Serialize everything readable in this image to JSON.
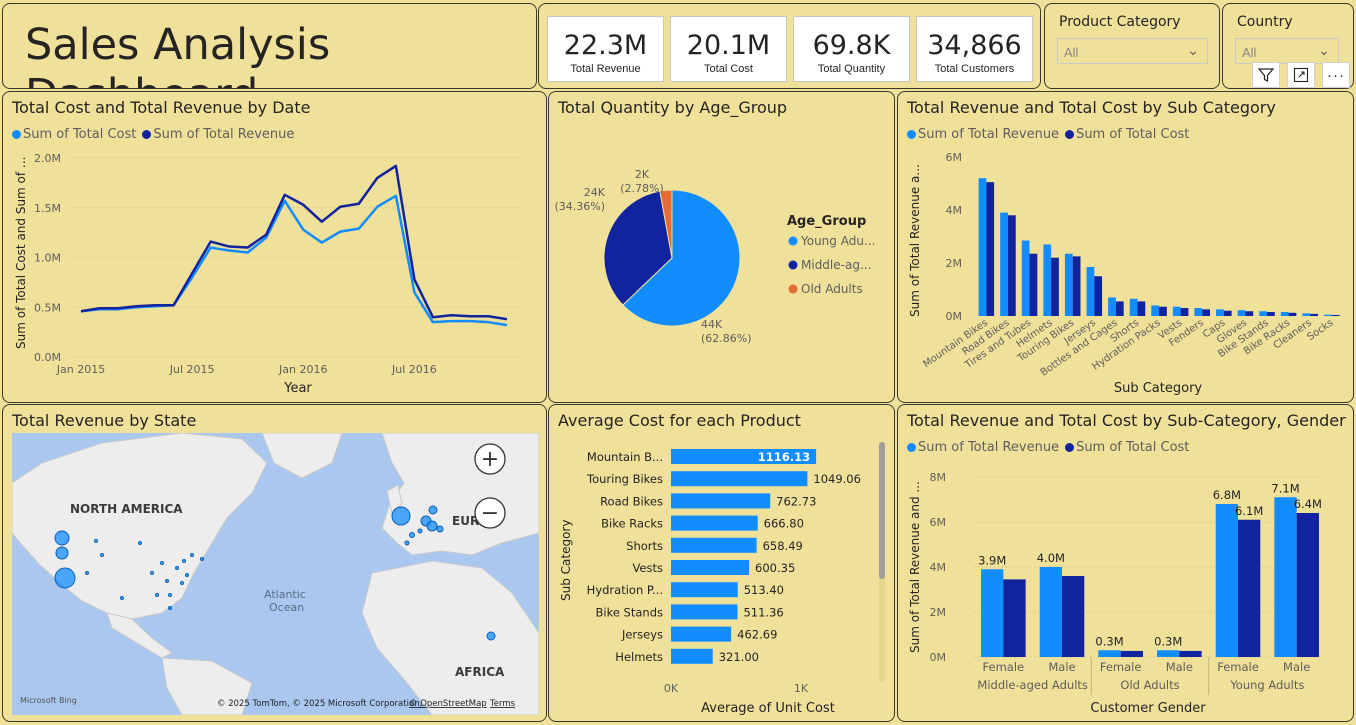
{
  "header": {
    "title": "Sales Analysis Dashboard"
  },
  "kpis": [
    {
      "value": "22.3M",
      "label": "Total Revenue"
    },
    {
      "value": "20.1M",
      "label": "Total Cost"
    },
    {
      "value": "69.8K",
      "label": "Total Quantity"
    },
    {
      "value": "34,866",
      "label": "Total Customers"
    }
  ],
  "slicers": {
    "product_category": {
      "title": "Product Category",
      "value": "All"
    },
    "country": {
      "title": "Country",
      "value": "All"
    }
  },
  "toolbar": {
    "filter_icon": "filter-icon",
    "focus_icon": "focus-mode-icon",
    "more_label": "···"
  },
  "colors": {
    "background": "#efe09a",
    "light_blue": "#118dff",
    "dark_blue": "#12239e",
    "orange": "#e66c37"
  },
  "chart_data": [
    {
      "type": "line",
      "title": "Total Cost and Total Revenue by Date",
      "xlabel": "Year",
      "ylabel": "Sum of Total Cost and Sum of ...",
      "x_ticks": [
        "Jan 2015",
        "Jul 2015",
        "Jan 2016",
        "Jul 2016"
      ],
      "y_ticks": [
        "0.0M",
        "0.5M",
        "1.0M",
        "1.5M",
        "2.0M"
      ],
      "ylim": [
        0,
        2.0
      ],
      "x": [
        "2015-01",
        "2015-02",
        "2015-03",
        "2015-04",
        "2015-05",
        "2015-06",
        "2015-07",
        "2015-08",
        "2015-09",
        "2015-10",
        "2015-11",
        "2015-12",
        "2016-01",
        "2016-02",
        "2016-03",
        "2016-04",
        "2016-05",
        "2016-06",
        "2016-07",
        "2016-08",
        "2016-09",
        "2016-10",
        "2016-11",
        "2016-12"
      ],
      "series": [
        {
          "name": "Sum of Total Cost",
          "color": "#118dff",
          "values": [
            0.46,
            0.48,
            0.48,
            0.5,
            0.51,
            0.52,
            0.8,
            1.1,
            1.07,
            1.05,
            1.2,
            1.57,
            1.28,
            1.15,
            1.26,
            1.29,
            1.51,
            1.62,
            0.65,
            0.35,
            0.36,
            0.36,
            0.35,
            0.32
          ]
        },
        {
          "name": "Sum of Total Revenue",
          "color": "#12239e",
          "values": [
            0.46,
            0.49,
            0.49,
            0.51,
            0.52,
            0.52,
            0.84,
            1.16,
            1.11,
            1.1,
            1.23,
            1.63,
            1.53,
            1.36,
            1.51,
            1.54,
            1.8,
            1.92,
            0.78,
            0.4,
            0.42,
            0.41,
            0.41,
            0.38
          ]
        }
      ]
    },
    {
      "type": "pie",
      "title": "Total Quantity by Age_Group",
      "legend_title": "Age_Group",
      "slices": [
        {
          "name": "Young Adu...",
          "value": 44,
          "label": "44K",
          "pct": "(62.86%)",
          "color": "#118dff"
        },
        {
          "name": "Middle-ag...",
          "value": 24,
          "label": "24K",
          "pct": "(34.36%)",
          "color": "#12239e"
        },
        {
          "name": "Old Adults",
          "value": 2,
          "label": "2K",
          "pct": "(2.78%)",
          "color": "#e66c37"
        }
      ]
    },
    {
      "type": "bar",
      "title": "Total Revenue and Total Cost by Sub Category",
      "xlabel": "Sub Category",
      "ylabel": "Sum of Total Revenue a...",
      "y_ticks": [
        "0M",
        "2M",
        "4M",
        "6M"
      ],
      "ylim": [
        0,
        6
      ],
      "categories": [
        "Mountain Bikes",
        "Road Bikes",
        "Tires and Tubes",
        "Helmets",
        "Touring Bikes",
        "Jerseys",
        "Bottles and Cages",
        "Shorts",
        "Hydration Packs",
        "Vests",
        "Fenders",
        "Caps",
        "Gloves",
        "Bike Stands",
        "Bike Racks",
        "Cleaners",
        "Socks"
      ],
      "series": [
        {
          "name": "Sum of Total Revenue",
          "color": "#118dff",
          "values": [
            5.2,
            3.9,
            2.85,
            2.7,
            2.35,
            1.85,
            0.7,
            0.65,
            0.4,
            0.35,
            0.3,
            0.25,
            0.22,
            0.18,
            0.15,
            0.1,
            0.05
          ]
        },
        {
          "name": "Sum of Total Cost",
          "color": "#12239e",
          "values": [
            5.05,
            3.8,
            2.35,
            2.2,
            2.25,
            1.5,
            0.55,
            0.55,
            0.35,
            0.3,
            0.25,
            0.2,
            0.18,
            0.15,
            0.12,
            0.08,
            0.04
          ]
        }
      ]
    },
    {
      "type": "map",
      "title": "Total Revenue by State",
      "labels": [
        "NORTH AMERICA",
        "Atlantic",
        "Ocean",
        "EUR",
        "AFRICA"
      ],
      "attribution_logo": "Microsoft Bing",
      "attribution": "© 2025 TomTom, © 2025 Microsoft Corporation,",
      "attribution_link": "© OpenStreetMap",
      "terms": "Terms",
      "zoom_in": "+",
      "zoom_out": "−"
    },
    {
      "type": "bar",
      "orientation": "horizontal",
      "title": "Average Cost for each Product",
      "xlabel": "Average of Unit Cost",
      "ylabel": "Sub Category",
      "x_ticks": [
        "0K",
        "1K"
      ],
      "xlim": [
        0,
        1000
      ],
      "categories": [
        "Mountain B...",
        "Touring Bikes",
        "Road Bikes",
        "Bike Racks",
        "Shorts",
        "Vests",
        "Hydration P...",
        "Bike Stands",
        "Jerseys",
        "Helmets"
      ],
      "values": [
        1116.13,
        1049.06,
        762.73,
        666.8,
        658.49,
        600.35,
        513.4,
        511.36,
        462.69,
        321.0
      ],
      "labels": [
        "1116.13",
        "1049.06",
        "762.73",
        "666.80",
        "658.49",
        "600.35",
        "513.40",
        "511.36",
        "462.69",
        "321.00"
      ],
      "color": "#118dff"
    },
    {
      "type": "bar",
      "title": "Total Revenue and Total Cost by Sub-Category, Gender",
      "xlabel": "Customer Gender",
      "ylabel": "Sum of Total Revenue and ...",
      "y_ticks": [
        "0M",
        "2M",
        "4M",
        "6M",
        "8M"
      ],
      "ylim": [
        0,
        8
      ],
      "categories": [
        "Female",
        "Male",
        "Female",
        "Male",
        "Female",
        "Male"
      ],
      "groups": [
        "Middle-aged Adults",
        "Old Adults",
        "Young Adults"
      ],
      "series": [
        {
          "name": "Sum of Total Revenue",
          "color": "#118dff",
          "values": [
            3.9,
            4.0,
            0.3,
            0.3,
            6.8,
            7.1
          ],
          "labels": [
            "3.9M",
            "4.0M",
            "0.3M",
            "0.3M",
            "6.8M",
            "7.1M"
          ]
        },
        {
          "name": "Sum of Total Cost",
          "color": "#12239e",
          "values": [
            3.45,
            3.6,
            0.27,
            0.27,
            6.1,
            6.4
          ],
          "labels": [
            "",
            "",
            "",
            "",
            "6.1M",
            "6.4M"
          ]
        }
      ]
    }
  ]
}
